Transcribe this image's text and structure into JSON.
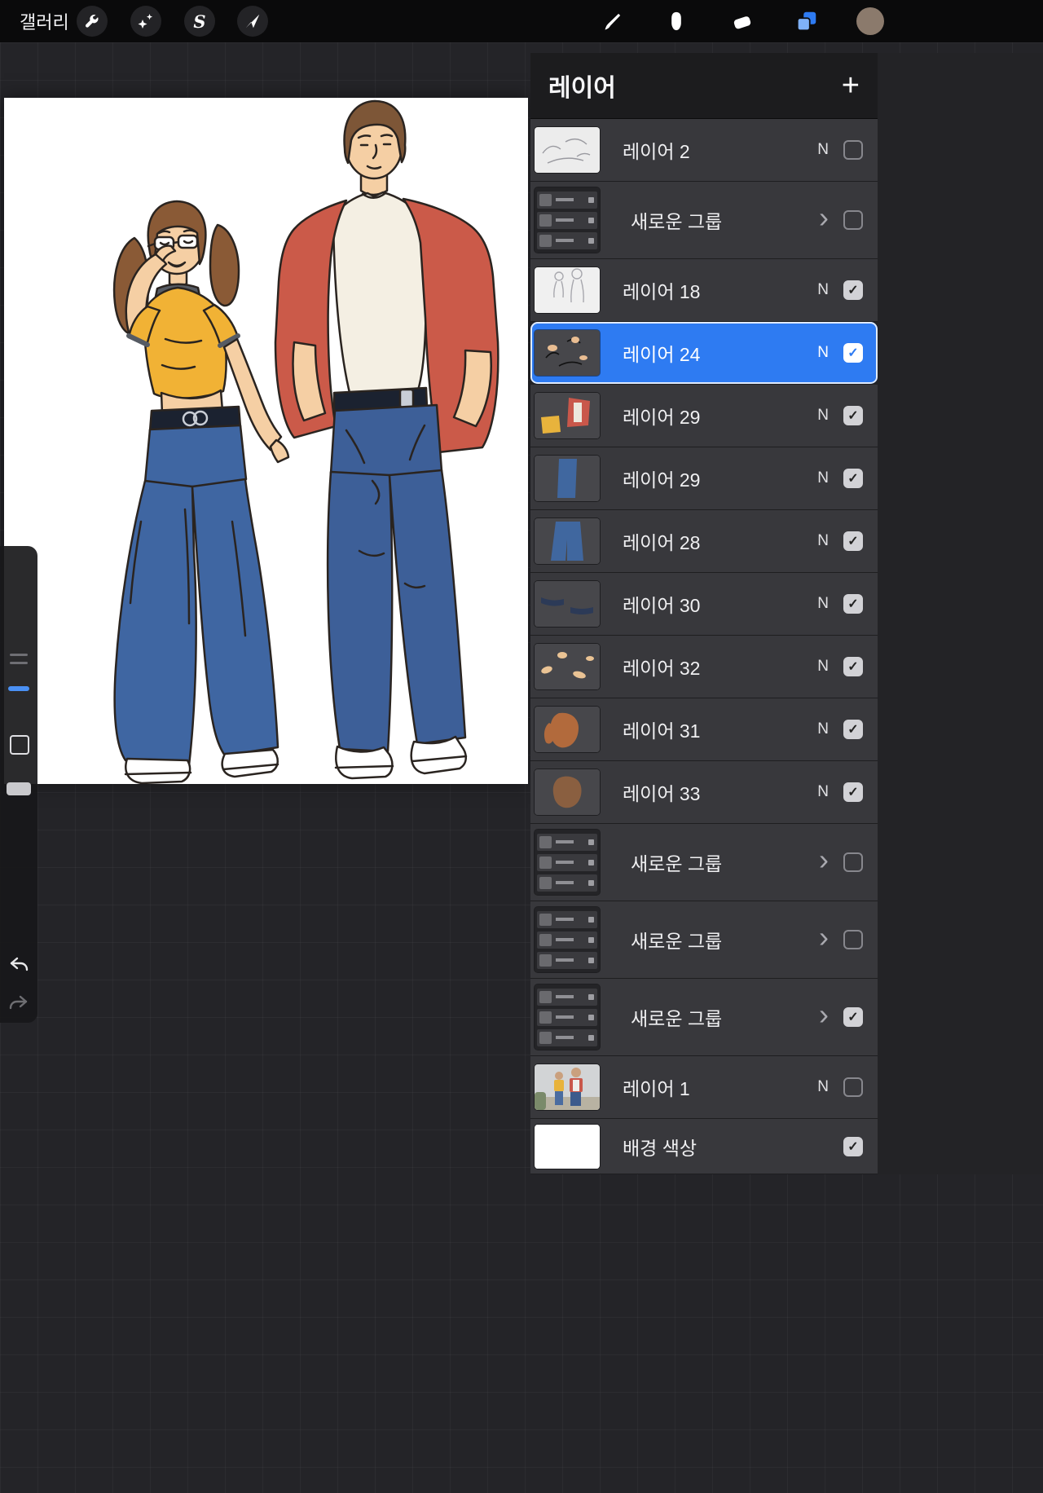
{
  "topbar": {
    "gallery_label": "갤러리",
    "left_tools": [
      "actions",
      "adjustments",
      "selection",
      "transform"
    ],
    "right_tools": [
      "paint",
      "smudge",
      "erase",
      "layers",
      "color"
    ],
    "active_tool": "layers",
    "current_color": "#8b7a6c"
  },
  "colors": {
    "accent_blue": "#2e7bf2",
    "selected_row": "#2e7bf2"
  },
  "sidebar": {
    "controls": [
      "brush-size-slider",
      "modify-button",
      "opacity-slider",
      "undo",
      "redo"
    ]
  },
  "layers_panel": {
    "title": "레이어",
    "add_button": "+",
    "items": [
      {
        "name": "레이어 2",
        "type": "layer",
        "blend": "N",
        "visible": false,
        "selected": false,
        "thumb": "sketch_light"
      },
      {
        "name": "새로운 그룹",
        "type": "group",
        "visible": false,
        "selected": false,
        "thumb": "group_a"
      },
      {
        "name": "레이어 18",
        "type": "layer",
        "blend": "N",
        "visible": true,
        "selected": false,
        "thumb": "sketch_figures"
      },
      {
        "name": "레이어 24",
        "type": "layer",
        "blend": "N",
        "visible": true,
        "selected": true,
        "thumb": "lineart"
      },
      {
        "name": "레이어 29",
        "type": "layer",
        "blend": "N",
        "visible": true,
        "selected": false,
        "thumb": "clothes"
      },
      {
        "name": "레이어 29",
        "type": "layer",
        "blend": "N",
        "visible": true,
        "selected": false,
        "thumb": "pants_a"
      },
      {
        "name": "레이어 28",
        "type": "layer",
        "blend": "N",
        "visible": true,
        "selected": false,
        "thumb": "pants_b"
      },
      {
        "name": "레이어 30",
        "type": "layer",
        "blend": "N",
        "visible": true,
        "selected": false,
        "thumb": "belts"
      },
      {
        "name": "레이어 32",
        "type": "layer",
        "blend": "N",
        "visible": true,
        "selected": false,
        "thumb": "skin_bits"
      },
      {
        "name": "레이어 31",
        "type": "layer",
        "blend": "N",
        "visible": true,
        "selected": false,
        "thumb": "hair_orange"
      },
      {
        "name": "레이어 33",
        "type": "layer",
        "blend": "N",
        "visible": true,
        "selected": false,
        "thumb": "hair_brown"
      },
      {
        "name": "새로운 그룹",
        "type": "group",
        "visible": false,
        "selected": false,
        "thumb": "group_b"
      },
      {
        "name": "새로운 그룹",
        "type": "group",
        "visible": false,
        "selected": false,
        "thumb": "group_c"
      },
      {
        "name": "새로운 그룹",
        "type": "group",
        "visible": true,
        "selected": false,
        "thumb": "group_d"
      },
      {
        "name": "레이어 1",
        "type": "layer",
        "blend": "N",
        "visible": false,
        "selected": false,
        "thumb": "photo"
      },
      {
        "name": "배경 색상",
        "type": "background",
        "visible": true,
        "selected": false,
        "thumb": "white"
      }
    ]
  }
}
